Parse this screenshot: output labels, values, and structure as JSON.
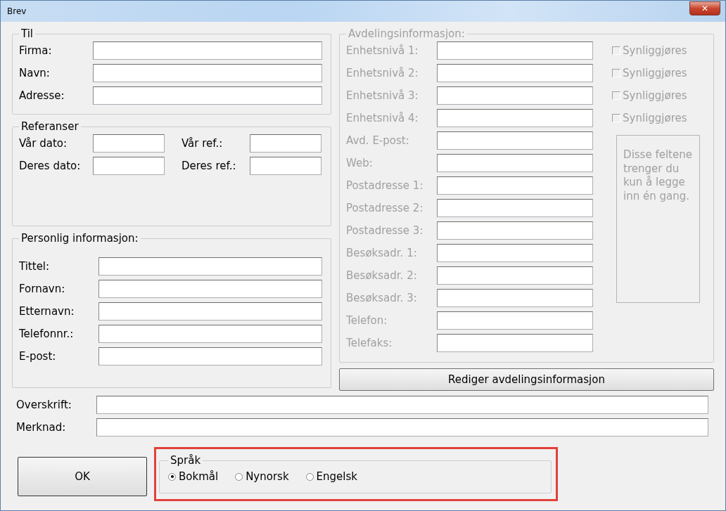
{
  "window": {
    "title": "Brev",
    "close": "✕"
  },
  "til": {
    "legend": "Til",
    "fields": [
      {
        "label": "Firma:"
      },
      {
        "label": "Navn:"
      },
      {
        "label": "Adresse:"
      }
    ]
  },
  "referanser": {
    "legend": "Referanser",
    "fields": [
      {
        "label": "Vår dato:"
      },
      {
        "label": "Vår ref.:"
      },
      {
        "label": "Deres dato:"
      },
      {
        "label": "Deres ref.:"
      }
    ]
  },
  "personlig": {
    "legend": "Personlig informasjon:",
    "fields": [
      {
        "label": "Tittel:"
      },
      {
        "label": "Fornavn:"
      },
      {
        "label": "Etternavn:"
      },
      {
        "label": "Telefonnr.:"
      },
      {
        "label": "E-post:"
      }
    ]
  },
  "avdeling": {
    "legend": "Avdelingsinformasjon:",
    "disabled": true,
    "fields": [
      {
        "label": "Enhetsnivå 1:",
        "checkbox": {
          "label": "Synliggjøres",
          "checked": false
        }
      },
      {
        "label": "Enhetsnivå 2:",
        "checkbox": {
          "label": "Synliggjøres",
          "checked": false
        }
      },
      {
        "label": "Enhetsnivå 3:",
        "checkbox": {
          "label": "Synliggjøres",
          "checked": false
        }
      },
      {
        "label": "Enhetsnivå 4:",
        "checkbox": {
          "label": "Synliggjøres",
          "checked": false
        }
      },
      {
        "label": "Avd. E-post:"
      },
      {
        "label": "Web:"
      },
      {
        "label": "Postadresse 1:"
      },
      {
        "label": "Postadresse 2:"
      },
      {
        "label": "Postadresse 3:"
      },
      {
        "label": "Besøksadr. 1:"
      },
      {
        "label": "Besøksadr. 2:"
      },
      {
        "label": "Besøksadr. 3:"
      },
      {
        "label": "Telefon:"
      },
      {
        "label": "Telefaks:"
      }
    ],
    "note": "Disse feltene trenger du kun å legge inn én gang."
  },
  "edit_button": "Rediger avdelingsinformasjon",
  "heading_fields": [
    {
      "label": "Overskrift:"
    },
    {
      "label": "Merknad:"
    }
  ],
  "ok_button": "OK",
  "language": {
    "legend": "Språk",
    "highlighted": true,
    "options": [
      {
        "label": "Bokmål",
        "selected": true
      },
      {
        "label": "Nynorsk",
        "selected": false
      },
      {
        "label": "Engelsk",
        "selected": false
      }
    ]
  }
}
